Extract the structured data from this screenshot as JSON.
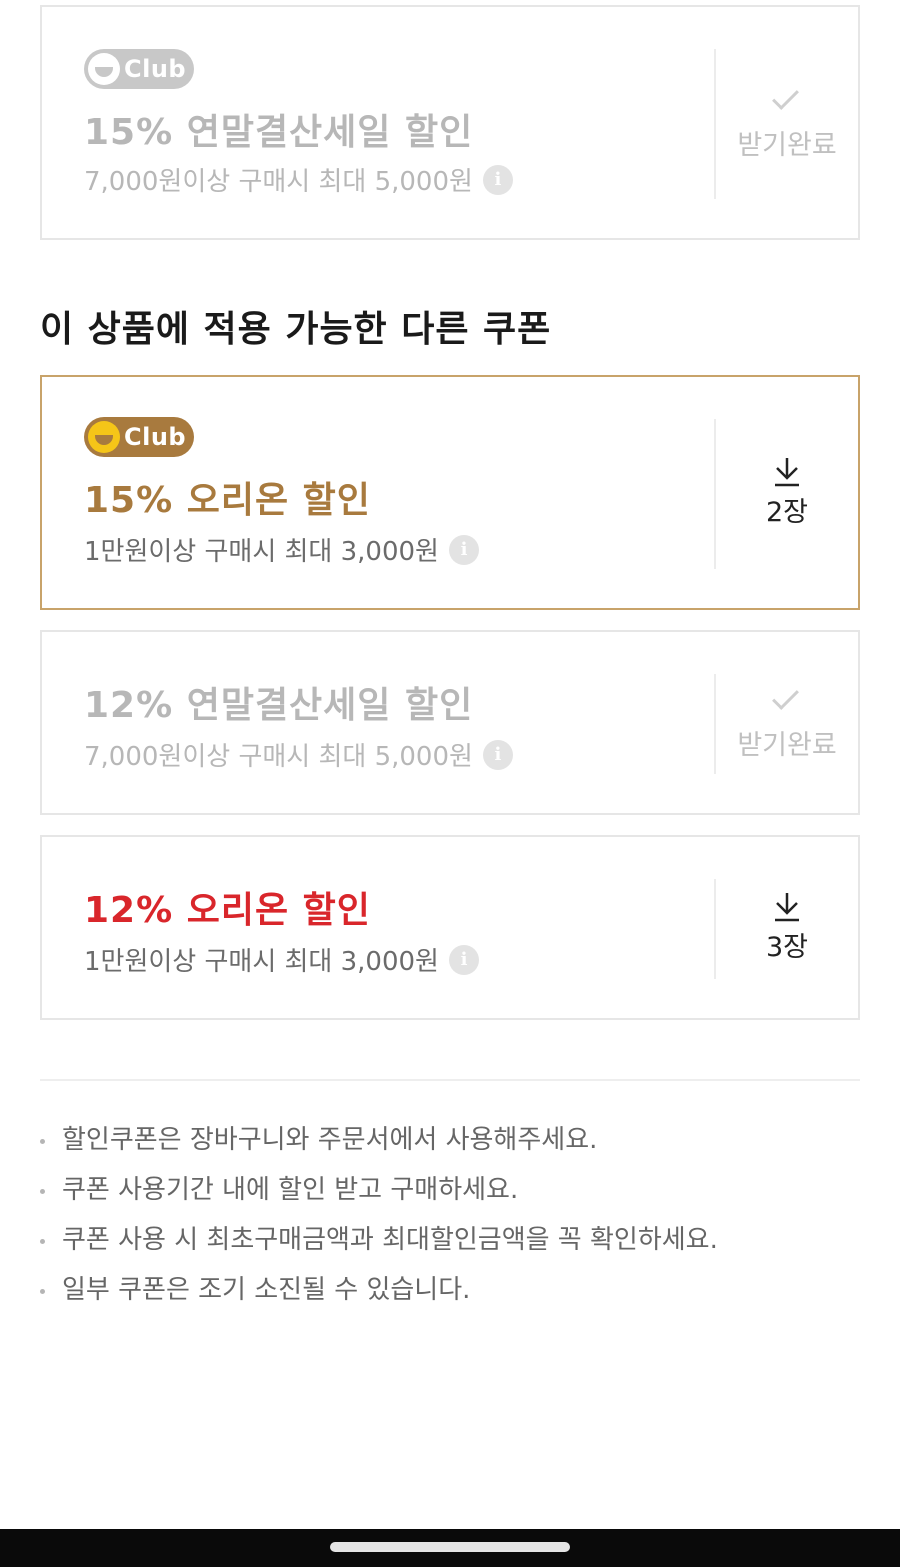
{
  "coupons_top": [
    {
      "badge": "Club",
      "title": "15% 연말결산세일 할인",
      "condition": "7,000원이상 구매시 최대 5,000원",
      "status": "받기완료"
    }
  ],
  "section_title": "이 상품에 적용 가능한 다른 쿠폰",
  "other_coupons": [
    {
      "badge": "Club",
      "title": "15% 오리온 할인",
      "condition": "1만원이상 구매시 최대 3,000원",
      "download_count": "2장"
    },
    {
      "title": "12% 연말결산세일 할인",
      "condition": "7,000원이상 구매시 최대 5,000원",
      "status": "받기완료"
    },
    {
      "title": "12% 오리온 할인",
      "condition": "1만원이상 구매시 최대 3,000원",
      "download_count": "3장"
    }
  ],
  "info_glyph": "i",
  "notes": [
    "할인쿠폰은 장바구니와 주문서에서 사용해주세요.",
    "쿠폰 사용기간 내에 할인 받고 구매하세요.",
    "쿠폰 사용 시 최초구매금액과 최대할인금액을 꼭 확인하세요.",
    "일부 쿠폰은 조기 소진될 수 있습니다."
  ],
  "icons": {
    "received": "checkmark-icon",
    "download": "download-arrow-icon",
    "info": "info-icon",
    "club": "club-logo-icon"
  },
  "colors": {
    "club_gold": "#a87a3e",
    "club_yellow": "#f5c518",
    "active_border": "#c8a36a",
    "red_title": "#d9262b",
    "disabled_gray": "#b7b7b7"
  }
}
